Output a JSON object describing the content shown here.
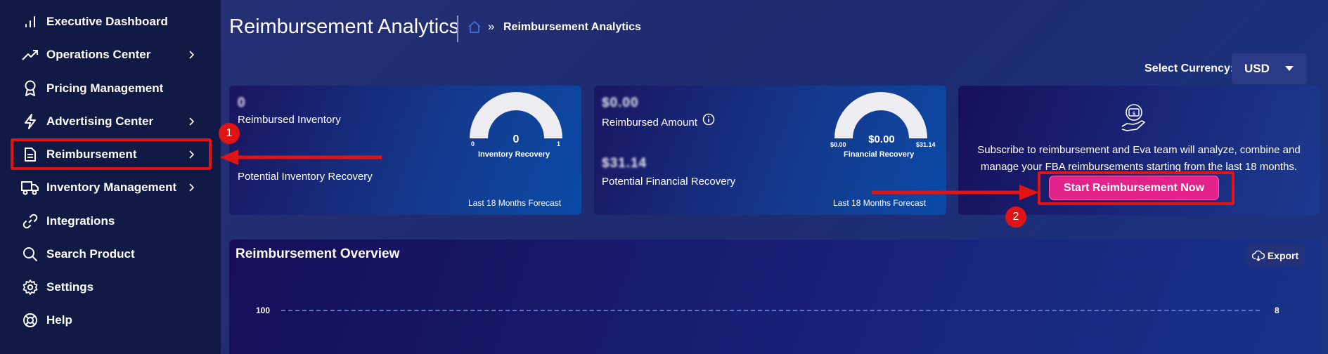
{
  "sidebar": {
    "items": [
      {
        "label": "Executive Dashboard",
        "icon": "bar-chart-icon",
        "chevron": false
      },
      {
        "label": "Operations Center",
        "icon": "trending-up-icon",
        "chevron": true
      },
      {
        "label": "Pricing Management",
        "icon": "award-icon",
        "chevron": false
      },
      {
        "label": "Advertising Center",
        "icon": "lightning-icon",
        "chevron": true
      },
      {
        "label": "Reimbursement",
        "icon": "document-icon",
        "chevron": true
      },
      {
        "label": "Inventory Management",
        "icon": "truck-icon",
        "chevron": true
      },
      {
        "label": "Integrations",
        "icon": "link-icon",
        "chevron": false
      },
      {
        "label": "Search Product",
        "icon": "search-icon",
        "chevron": false
      },
      {
        "label": "Settings",
        "icon": "gear-icon",
        "chevron": false
      },
      {
        "label": "Help",
        "icon": "lifebuoy-icon",
        "chevron": false
      }
    ]
  },
  "header": {
    "title": "Reimbursement Analytics",
    "breadcrumb_sep": "»",
    "breadcrumb_current": "Reimbursement Analytics"
  },
  "currency": {
    "label": "Select Currency:",
    "value": "USD"
  },
  "card_inventory": {
    "value": "0",
    "label": "Reimbursed Inventory",
    "potential_label": "Potential Inventory Recovery",
    "gauge_value": "0",
    "gauge_min": "0",
    "gauge_max": "1",
    "gauge_label": "Inventory Recovery",
    "forecast": "Last 18 Months Forecast"
  },
  "card_financial": {
    "value": "$0.00",
    "label": "Reimbursed Amount",
    "potential_value": "$31.14",
    "potential_label": "Potential Financial Recovery",
    "gauge_value": "$0.00",
    "gauge_min": "$0.00",
    "gauge_max": "$31.14",
    "gauge_label": "Financial Recovery",
    "forecast": "Last 18 Months Forecast"
  },
  "card_subscribe": {
    "description": "Subscribe to reimbursement and Eva team will analyze, combine and manage your FBA reimbursements starting from the last 18 months.",
    "button_label": "Start Reimbursement Now"
  },
  "overview": {
    "title": "Reimbursement Overview",
    "export_label": "Export",
    "y_left_tick": "100",
    "y_right_tick": "8"
  },
  "annotations": {
    "badge1": "1",
    "badge2": "2",
    "color": "#e01414"
  }
}
